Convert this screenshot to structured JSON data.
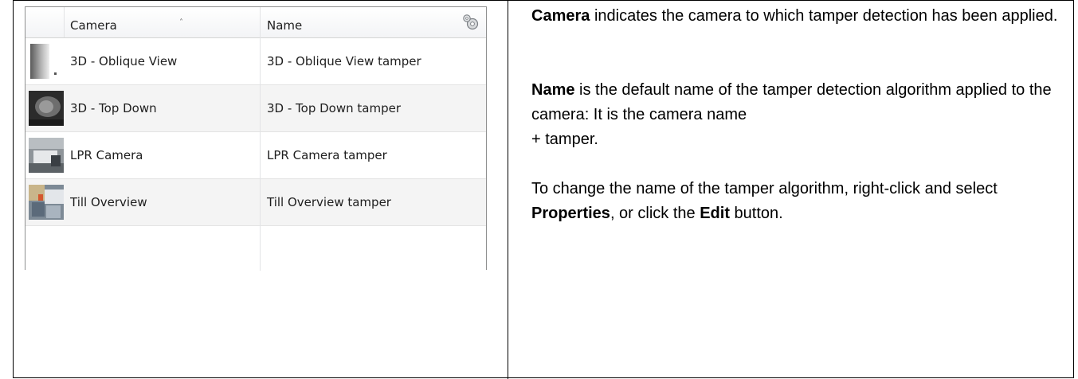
{
  "grid": {
    "columns": [
      {
        "label": "Camera",
        "sorted": "ascending"
      },
      {
        "label": "Name"
      }
    ],
    "settings_icon": "gear-icon",
    "rows": [
      {
        "camera": "3D - Oblique View",
        "name": "3D - Oblique View tamper",
        "thumbnail": "camera-thumbnail"
      },
      {
        "camera": "3D - Top Down",
        "name": "3D - Top Down tamper",
        "thumbnail": "camera-thumbnail"
      },
      {
        "camera": "LPR Camera",
        "name": "LPR Camera tamper",
        "thumbnail": "camera-thumbnail"
      },
      {
        "camera": "Till Overview",
        "name": "Till Overview tamper",
        "thumbnail": "camera-thumbnail"
      }
    ]
  },
  "description": {
    "camera_term": "Camera",
    "camera_text": " indicates the camera to which tamper detection has been applied.",
    "name_term": "Name",
    "name_text_1": " is the default name of the tamper detection algorithm applied to the camera: It is the camera name",
    "name_text_2": "+ tamper.",
    "change_text_1": "To change the name of the tamper algorithm, right-click and select ",
    "properties_term": "Properties",
    "change_text_2": ", or click the ",
    "edit_term": "Edit",
    "change_text_3": " button."
  }
}
